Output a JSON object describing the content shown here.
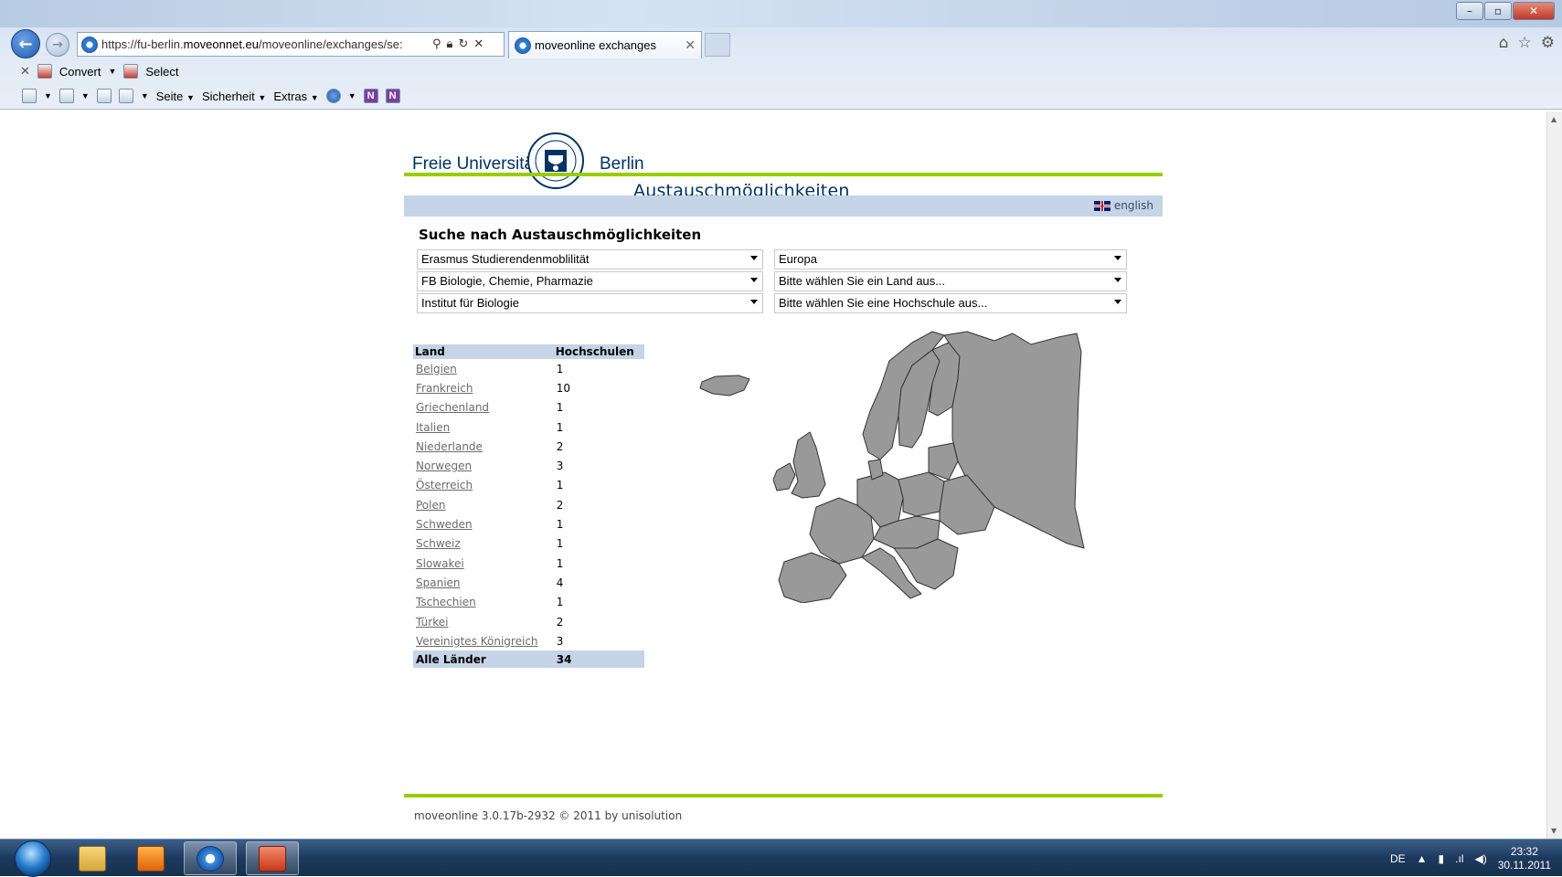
{
  "browser": {
    "url_host_prefix": "https://fu-berlin.",
    "url_host_domain": "moveonnet.eu",
    "url_path": "/moveonline/exchanges/se:",
    "tab_title": "moveonline exchanges",
    "command_bar_1": {
      "convert_label": "Convert",
      "select_label": "Select"
    },
    "command_bar_2": {
      "seite_label": "Seite",
      "sicherheit_label": "Sicherheit",
      "extras_label": "Extras"
    }
  },
  "site": {
    "logo_left": "Freie Universität",
    "logo_right": "Berlin",
    "subtitle": "Austauschmöglichkeiten",
    "language_link": "english"
  },
  "search": {
    "heading": "Suche nach Austauschmöglichkeiten",
    "programme": "Erasmus Studierendenmoblilität",
    "region": "Europa",
    "faculty": "FB Biologie, Chemie, Pharmazie",
    "country": "Bitte wählen Sie ein Land aus...",
    "institute": "Institut für Biologie",
    "university": "Bitte wählen Sie eine Hochschule aus..."
  },
  "country_table": {
    "headers": {
      "land": "Land",
      "hochschulen": "Hochschulen"
    },
    "rows": [
      {
        "land": "Belgien",
        "count": "1"
      },
      {
        "land": "Frankreich",
        "count": "10"
      },
      {
        "land": "Griechenland",
        "count": "1"
      },
      {
        "land": "Italien",
        "count": "1"
      },
      {
        "land": "Niederlande",
        "count": "2"
      },
      {
        "land": "Norwegen",
        "count": "3"
      },
      {
        "land": "Österreich",
        "count": "1"
      },
      {
        "land": "Polen",
        "count": "2"
      },
      {
        "land": "Schweden",
        "count": "1"
      },
      {
        "land": "Schweiz",
        "count": "1"
      },
      {
        "land": "Slowakei",
        "count": "1"
      },
      {
        "land": "Spanien",
        "count": "4"
      },
      {
        "land": "Tschechien",
        "count": "1"
      },
      {
        "land": "Türkei",
        "count": "2"
      },
      {
        "land": "Vereinigtes Königreich",
        "count": "3"
      }
    ],
    "total": {
      "land": "Alle Länder",
      "count": "34"
    }
  },
  "footer": {
    "text": "moveonline 3.0.17b-2932 © 2011 by unisolution"
  },
  "taskbar": {
    "language": "DE",
    "time": "23:32",
    "date": "30.11.2011"
  },
  "colors": {
    "accent_green": "#99cc00",
    "header_blue": "#003366",
    "table_header_bg": "#c5d4e6",
    "map_fill": "#999999"
  },
  "icons": [
    "back-icon",
    "forward-icon",
    "ie-icon",
    "search-icon",
    "lock-icon",
    "refresh-icon",
    "stop-icon",
    "home-icon",
    "favorites-icon",
    "settings-icon",
    "feeds-icon",
    "mail-icon",
    "print-icon",
    "help-icon",
    "onenote-icon",
    "start-orb-icon",
    "explorer-icon",
    "media-player-icon",
    "powerpoint-icon"
  ]
}
